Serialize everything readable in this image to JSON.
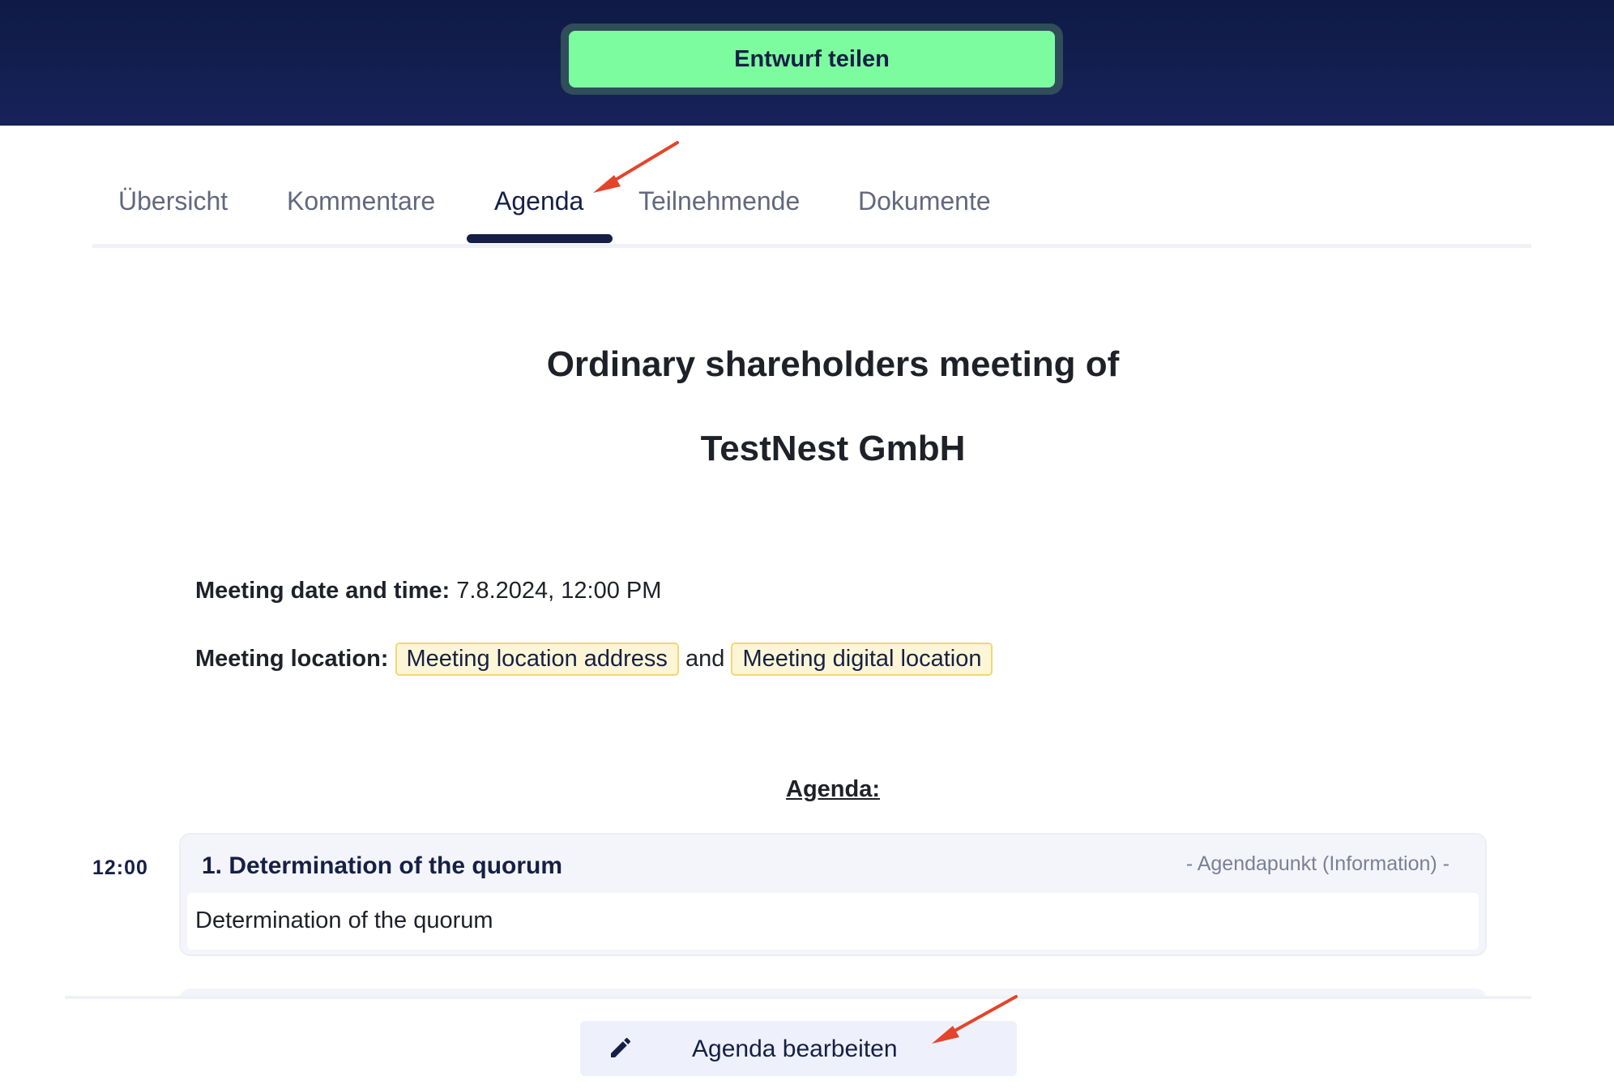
{
  "header": {
    "share_button": "Entwurf teilen"
  },
  "tabs": [
    {
      "label": "Übersicht",
      "active": false
    },
    {
      "label": "Kommentare",
      "active": false
    },
    {
      "label": "Agenda",
      "active": true
    },
    {
      "label": "Teilnehmende",
      "active": false
    },
    {
      "label": "Dokumente",
      "active": false
    }
  ],
  "document": {
    "title_line1": "Ordinary shareholders meeting of",
    "title_line2": "TestNest GmbH",
    "date_label": "Meeting date and time:",
    "date_value": "7.8.2024, 12:00 PM",
    "location_label": "Meeting location:",
    "location_address": "Meeting location address",
    "location_joiner": "and",
    "location_digital": "Meeting digital location",
    "agenda_heading": "Agenda:"
  },
  "agenda_items": [
    {
      "time": "12:00",
      "title": "1. Determination of the quorum",
      "type": "- Agendapunkt (Information) -",
      "description": "Determination of the quorum"
    }
  ],
  "footer": {
    "edit_button": "Agenda bearbeiten",
    "edit_icon": "pencil-icon"
  },
  "colors": {
    "header_bg": "#17225a",
    "share_button_bg": "#7dfb9f",
    "primary_text": "#162046",
    "annotation_arrow": "#e4442b",
    "chip_border": "#f2d774"
  }
}
